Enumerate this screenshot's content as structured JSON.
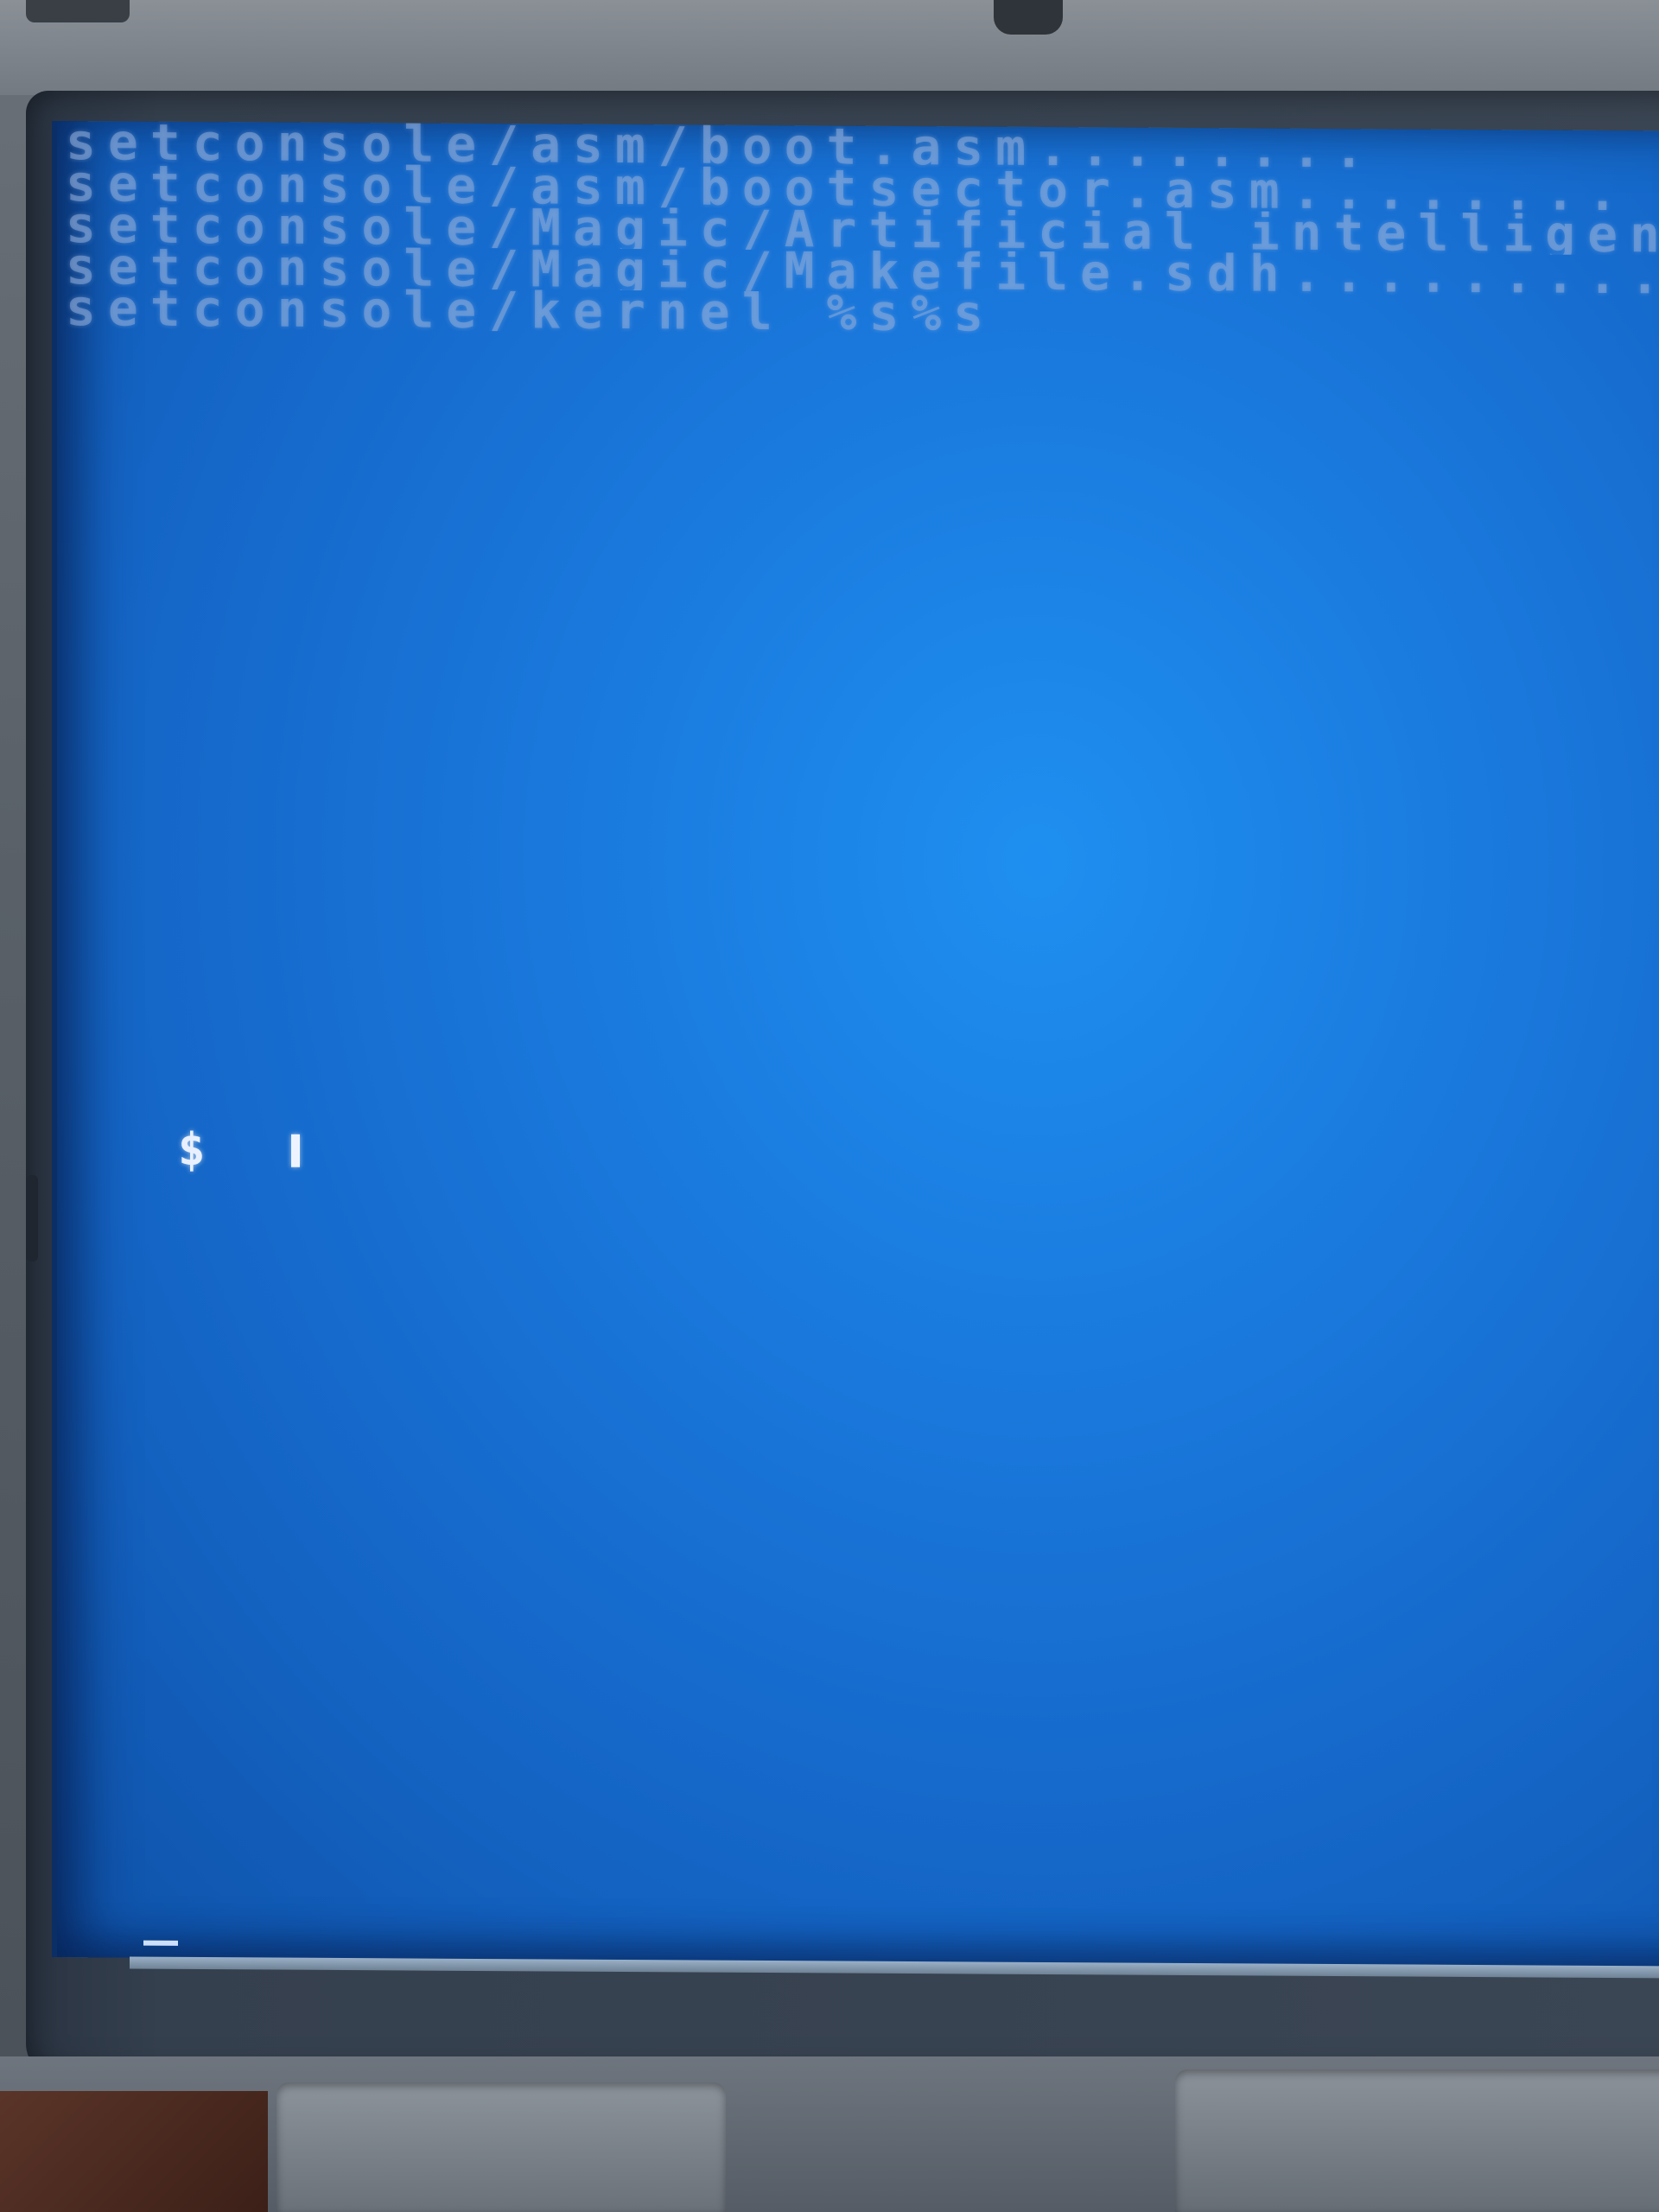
{
  "console": {
    "lines": [
      "setconsole/asm/boot.asm........",
      "setconsole/asm/bootsector.asm........",
      "setconsole/Magic/Artificial intelligence........",
      "setconsole/Magic/Makefile.sdh............",
      "setconsole/kernel %s%s"
    ],
    "prompt": "$"
  },
  "colors": {
    "screen_blue": "#1a78dc",
    "text_dim": "#8caad7",
    "prompt_white": "#e8f0ff"
  }
}
